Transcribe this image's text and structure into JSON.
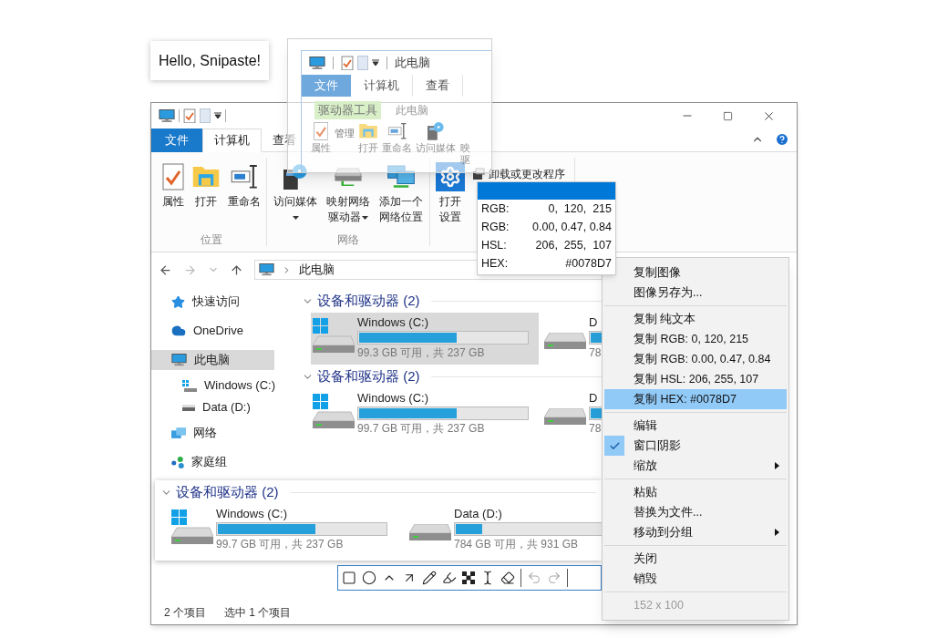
{
  "hello_snip": {
    "text": "Hello, Snipaste!"
  },
  "overlay_snip": {
    "title": "此电脑",
    "tabs": [
      {
        "label": "文件",
        "kind": "file",
        "selected": false
      },
      {
        "label": "计算机",
        "kind": "tab",
        "selected": false
      },
      {
        "label": "查看",
        "kind": "tab",
        "selected": false
      }
    ],
    "context_tab": "驱动器工具",
    "context_title": "此电脑",
    "context_action": "管理",
    "buttons": [
      {
        "label": "属性",
        "kind": "properties"
      },
      {
        "label": "打开",
        "kind": "open"
      },
      {
        "label": "重命名",
        "kind": "rename"
      },
      {
        "label": "访问媒体",
        "kind": "media"
      },
      {
        "label": "映驱",
        "kind": "cut"
      }
    ]
  },
  "explorer": {
    "tabs": [
      {
        "label": "文件",
        "kind": "file",
        "selected": false
      },
      {
        "label": "计算机",
        "kind": "tab",
        "selected": true
      },
      {
        "label": "查看",
        "kind": "tab",
        "selected": false
      }
    ],
    "ribbon_groups": [
      {
        "label": "位置",
        "buttons": [
          {
            "label": "属性",
            "kind": "properties",
            "dropdown": false
          },
          {
            "label": "打开",
            "kind": "open",
            "dropdown": false
          },
          {
            "label": "重命名",
            "kind": "rename",
            "dropdown": false
          }
        ]
      },
      {
        "label": "网络",
        "buttons": [
          {
            "label": "访问媒体",
            "kind": "media",
            "dropdown": true
          },
          {
            "label": "映射网络驱动器",
            "kind": "map_drive",
            "dropdown": true
          },
          {
            "label": "添加一个网络位置",
            "kind": "add_location",
            "dropdown": false
          }
        ]
      },
      {
        "buttons": [
          {
            "label": "打开设置",
            "kind": "settings",
            "dropdown": false
          }
        ],
        "small_buttons": [
          {
            "label": "卸载或更改程序",
            "kind": "uninstall"
          }
        ]
      }
    ],
    "address": {
      "path": "此电脑"
    },
    "nav": [
      {
        "label": "快速访问",
        "kind": "quick_access",
        "selected": false
      },
      {
        "label": "OneDrive",
        "kind": "cloud",
        "selected": false
      },
      {
        "label": "此电脑",
        "kind": "pc",
        "selected": true,
        "children": [
          {
            "label": "Windows (C:)",
            "kind": "system_drive",
            "selected": false
          },
          {
            "label": "Data (D:)",
            "kind": "drive",
            "selected": false
          }
        ]
      },
      {
        "label": "网络",
        "kind": "network",
        "selected": false
      },
      {
        "label": "家庭组",
        "kind": "homegroup",
        "selected": false
      }
    ],
    "sections": [
      {
        "title": "设备和驱动器 (2)",
        "drives": [
          {
            "name": "Windows (C:)",
            "kind": "system",
            "level": 0.58,
            "info": "99.3 GB 可用，共 237 GB",
            "selected": true
          },
          {
            "name": "D",
            "kind": "data",
            "level": 0.16,
            "info": "78",
            "selected": false
          }
        ]
      },
      {
        "title": "设备和驱动器 (2)",
        "drives": [
          {
            "name": "Windows (C:)",
            "kind": "system",
            "level": 0.58,
            "info": "99.7 GB 可用，共 237 GB",
            "selected": false
          },
          {
            "name": "D",
            "kind": "data",
            "level": 0.16,
            "info": "78",
            "selected": false
          }
        ]
      }
    ],
    "status_bar": [
      "2 个项目",
      "选中 1 个项目"
    ]
  },
  "drive_snip": {
    "title": "设备和驱动器 (2)",
    "drives": [
      {
        "name": "Windows (C:)",
        "kind": "system",
        "level": 0.58,
        "info": "99.7 GB 可用，共 237 GB",
        "selected": false
      },
      {
        "name": "Data (D:)",
        "kind": "data",
        "level": 0.16,
        "info": "784 GB 可用，共 931 GB",
        "selected": false
      }
    ]
  },
  "color_info": {
    "color": "#0078d7",
    "rows": [
      {
        "label": "RGB:",
        "value": "0,  120,  215"
      },
      {
        "label": "RGB:",
        "value": "0.00, 0.47, 0.84"
      },
      {
        "label": "HSL:",
        "value": "206,  255,  107"
      },
      {
        "label": "HEX:",
        "value": "#0078D7"
      }
    ]
  },
  "context_menu": {
    "groups": [
      [
        {
          "label": "复制图像",
          "selected": false,
          "checked": false,
          "submenu": false,
          "disabled": false
        },
        {
          "label": "图像另存为...",
          "selected": false,
          "checked": false,
          "submenu": false,
          "disabled": false
        }
      ],
      [
        {
          "label": "复制 纯文本",
          "selected": false,
          "checked": false,
          "submenu": false,
          "disabled": false
        },
        {
          "label": "复制 RGB: 0, 120, 215",
          "selected": false,
          "checked": false,
          "submenu": false,
          "disabled": false
        },
        {
          "label": "复制 RGB: 0.00, 0.47, 0.84",
          "selected": false,
          "checked": false,
          "submenu": false,
          "disabled": false
        },
        {
          "label": "复制 HSL: 206, 255, 107",
          "selected": false,
          "checked": false,
          "submenu": false,
          "disabled": false
        },
        {
          "label": "复制 HEX: #0078D7",
          "selected": true,
          "checked": false,
          "submenu": false,
          "disabled": false
        }
      ],
      [
        {
          "label": "编辑",
          "selected": false,
          "checked": false,
          "submenu": false,
          "disabled": false
        },
        {
          "label": "窗口阴影",
          "selected": false,
          "checked": true,
          "submenu": false,
          "disabled": false
        },
        {
          "label": "缩放",
          "selected": false,
          "checked": false,
          "submenu": true,
          "disabled": false
        }
      ],
      [
        {
          "label": "粘贴",
          "selected": false,
          "checked": false,
          "submenu": false,
          "disabled": false
        },
        {
          "label": "替换为文件...",
          "selected": false,
          "checked": false,
          "submenu": false,
          "disabled": false
        },
        {
          "label": "移动到分组",
          "selected": false,
          "checked": false,
          "submenu": true,
          "disabled": false
        }
      ],
      [
        {
          "label": "关闭",
          "selected": false,
          "checked": false,
          "submenu": false,
          "disabled": false
        },
        {
          "label": "销毁",
          "selected": false,
          "checked": false,
          "submenu": false,
          "disabled": false
        }
      ],
      [
        {
          "label": "152 x 100",
          "selected": false,
          "checked": false,
          "submenu": false,
          "disabled": true
        }
      ]
    ]
  }
}
